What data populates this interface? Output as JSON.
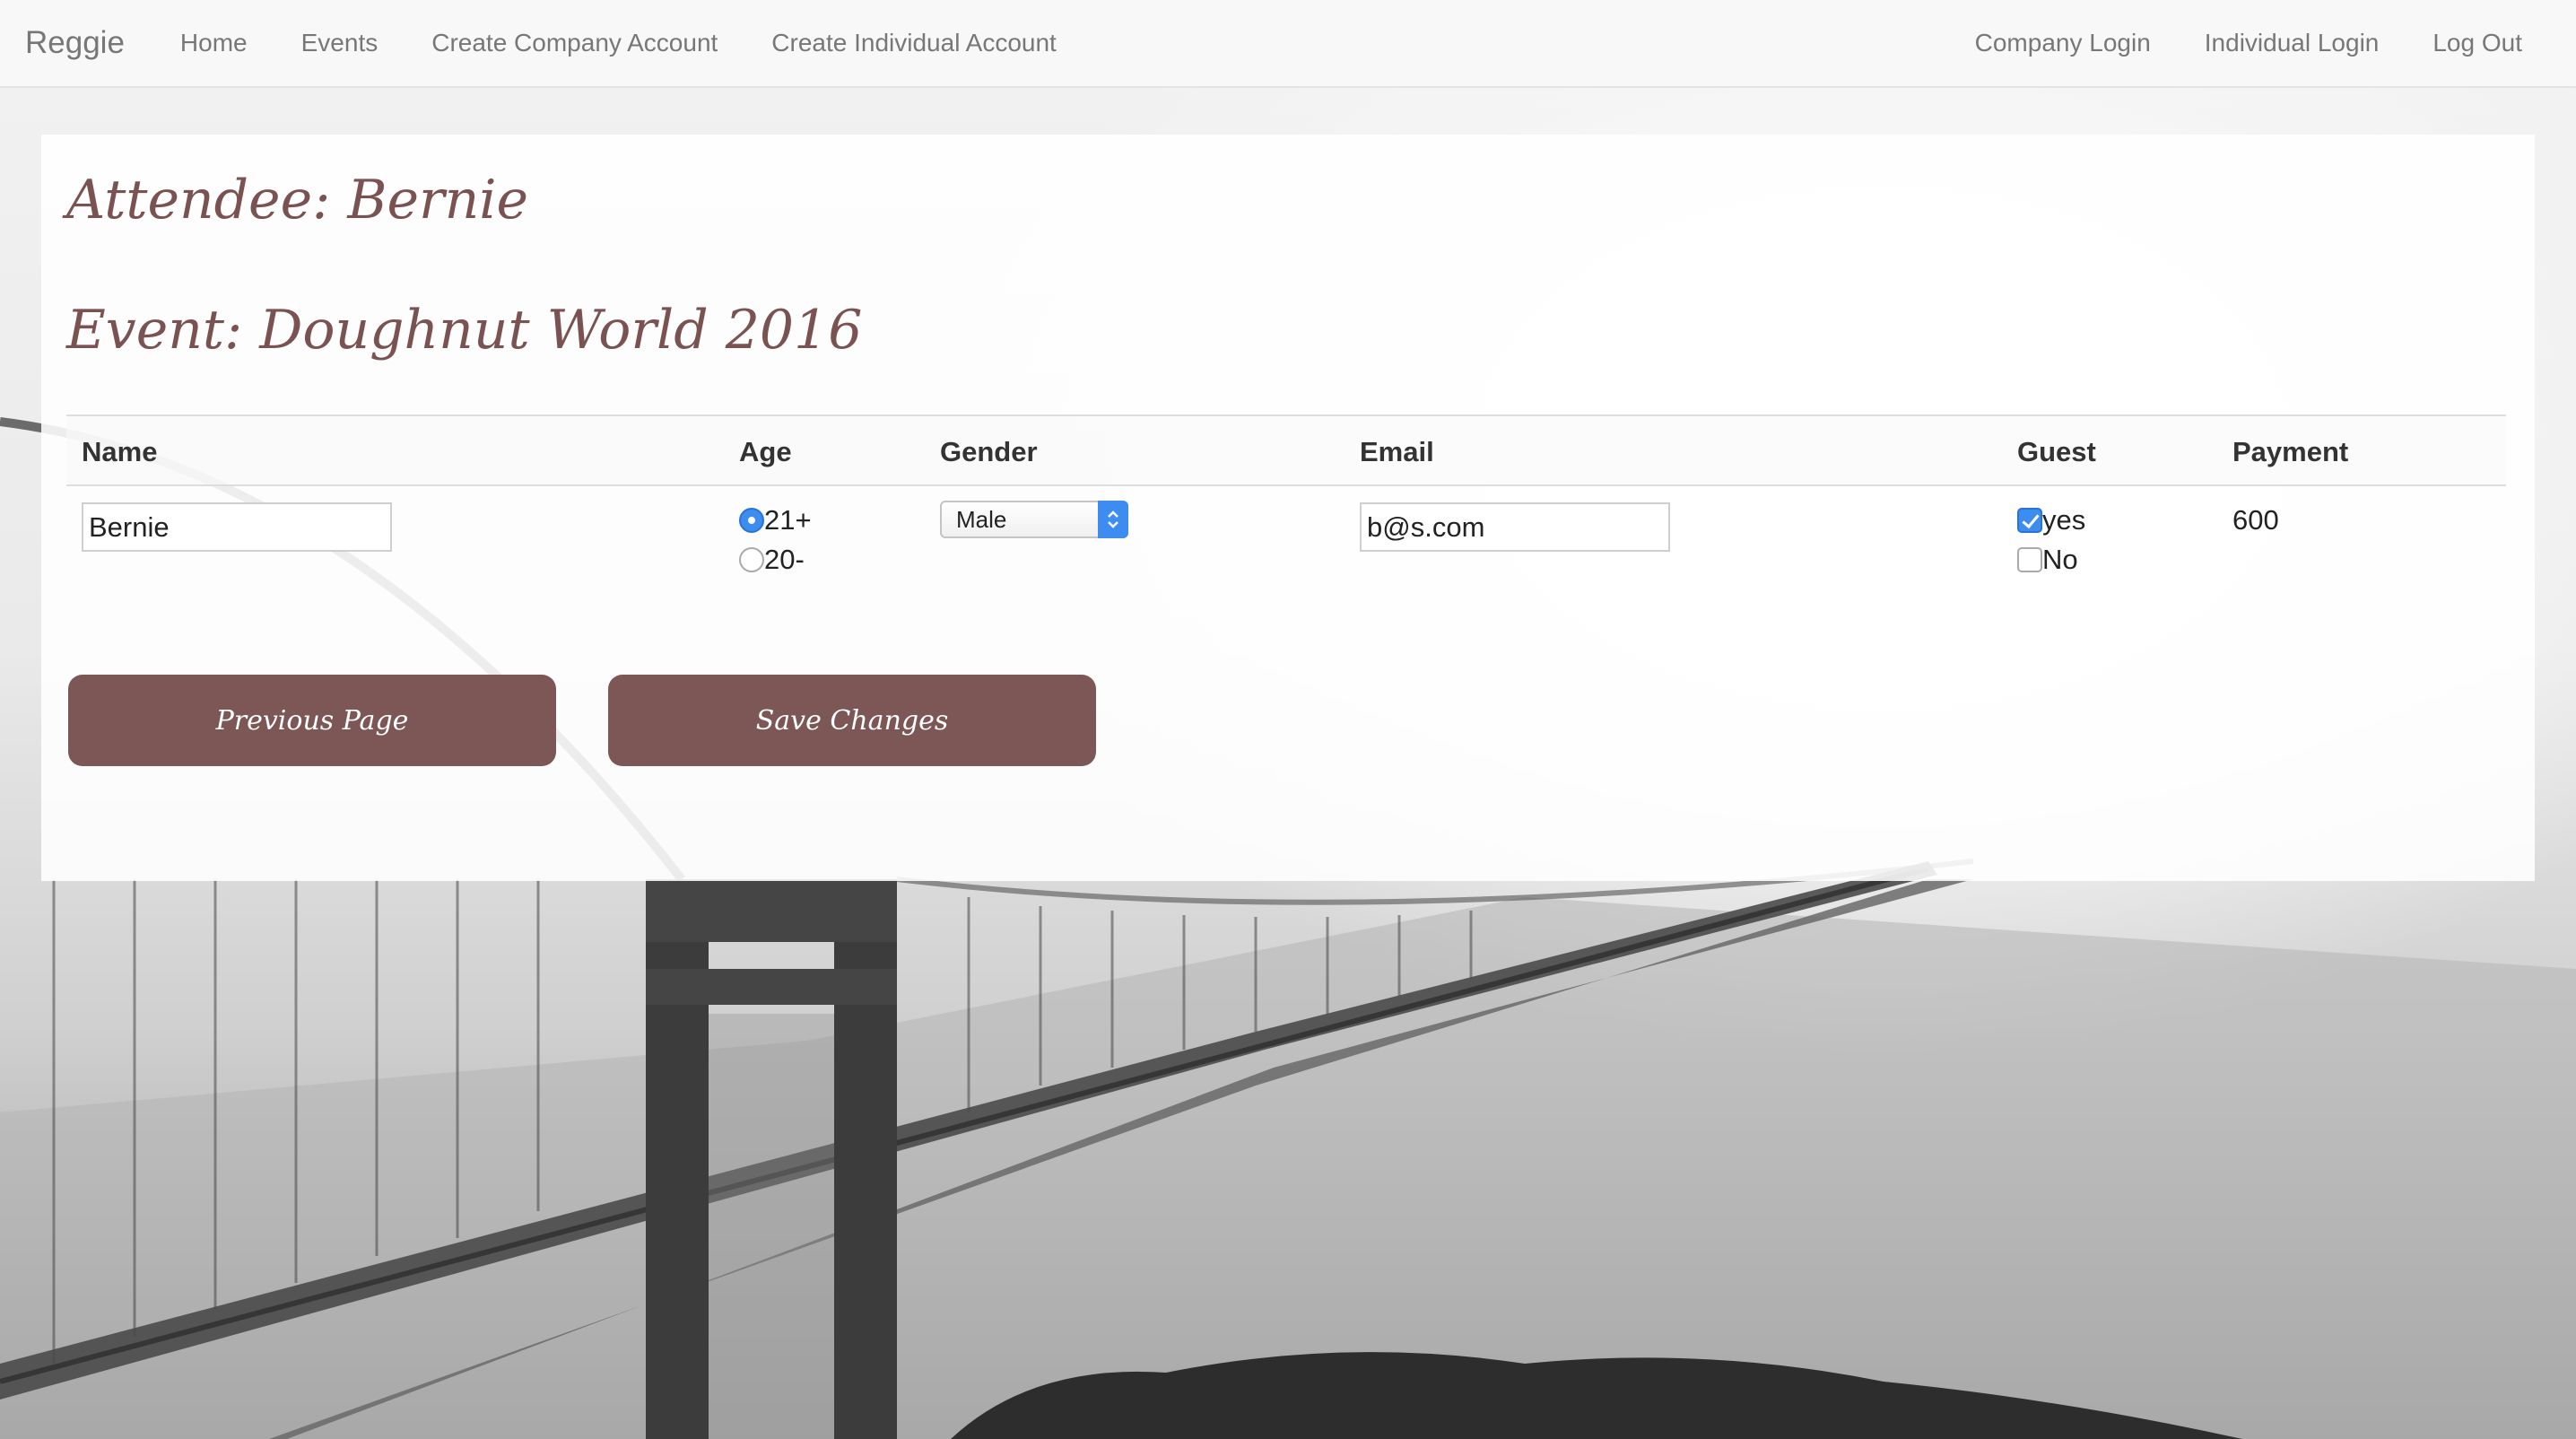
{
  "navbar": {
    "brand": "Reggie",
    "left_links": [
      "Home",
      "Events",
      "Create Company Account",
      "Create Individual Account"
    ],
    "right_links": [
      "Company Login",
      "Individual Login",
      "Log Out"
    ]
  },
  "page": {
    "attendee_heading": "Attendee: Bernie",
    "event_heading": "Event: Doughnut World 2016"
  },
  "table": {
    "headers": [
      "Name",
      "Age",
      "Gender",
      "Email",
      "Guest",
      "Payment"
    ],
    "row": {
      "name_value": "Bernie",
      "age_options": [
        "21+",
        "20-"
      ],
      "age_selected": "21+",
      "gender_selected": "Male",
      "email_value": "b@s.com",
      "guest_options": [
        "yes",
        "No"
      ],
      "guest_checked": "yes",
      "payment": "600"
    }
  },
  "buttons": {
    "previous": "Previous Page",
    "save": "Save Changes"
  },
  "colors": {
    "accent": "#7d5656",
    "heading": "#7a5252",
    "control_blue": "#3d8cf0"
  }
}
